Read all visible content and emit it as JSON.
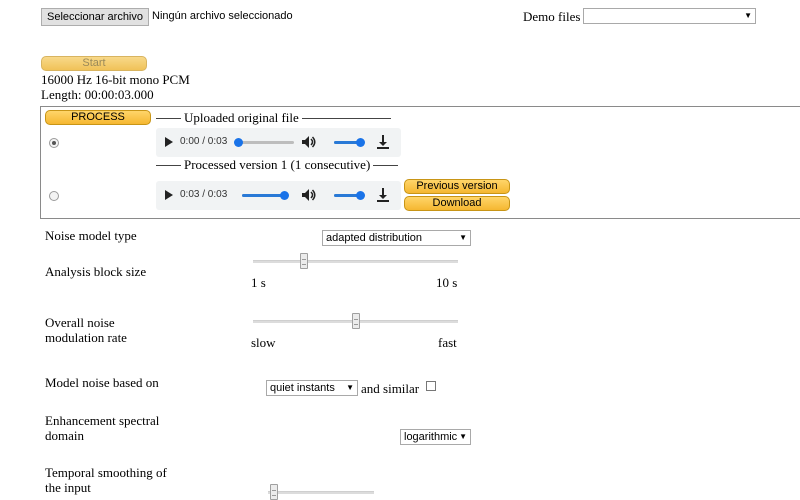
{
  "file_input": {
    "button_label": "Seleccionar archivo",
    "status": "Ningún archivo seleccionado"
  },
  "demo": {
    "label": "Demo files",
    "selected": ""
  },
  "start_label": "Start",
  "info": {
    "format": "16000 Hz 16-bit mono PCM",
    "length": "Length: 00:00:03.000"
  },
  "panel": {
    "process_label": "PROCESS",
    "original_legend": "Uploaded original file",
    "processed_legend": "Processed version 1 (1 consecutive)",
    "original_player": {
      "time": "0:00 / 0:03",
      "progress": 0.0,
      "volume": 1.0
    },
    "processed_player": {
      "time": "0:03 / 0:03",
      "progress": 1.0,
      "volume": 1.0
    },
    "previous_version_label": "Previous version",
    "download_label": "Download",
    "accent_color": "#1a73e8"
  },
  "settings": {
    "noise_model_type": {
      "label": "Noise model type",
      "value": "adapted distribution"
    },
    "analysis_block_size": {
      "label": "Analysis block size",
      "min_label": "1 s",
      "max_label": "10 s",
      "level": 0.24
    },
    "modulation_rate": {
      "label_line1": "Overall noise",
      "label_line2": "modulation rate",
      "min_label": "slow",
      "max_label": "fast",
      "level": 0.5
    },
    "model_noise": {
      "label": "Model noise based on",
      "value": "quiet instants",
      "suffix": "and similar",
      "checked": false
    },
    "spectral_domain": {
      "label_line1": "Enhancement spectral",
      "label_line2": "domain",
      "value": "logarithmic"
    },
    "temporal_smoothing": {
      "label_line1": "Temporal smoothing of",
      "label_line2": "the input",
      "level": 0.02
    }
  },
  "icons": {
    "play": "play-icon",
    "volume": "volume-icon",
    "download": "download-icon"
  }
}
